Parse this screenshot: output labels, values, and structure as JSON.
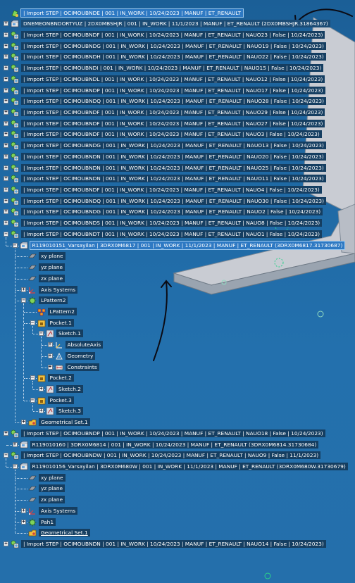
{
  "tree": [
    {
      "id": "r0",
      "label": "| Import STEP | OCIMOUBNDE | 001 | IN_WORK | 10/24/2023 | MANUF | ET_RENAULT",
      "icon": "part-icon",
      "depth": 0,
      "exp": "",
      "style": "sel"
    },
    {
      "id": "r1",
      "label": "DNEMEONBNDORTYUZ | 2DX0MBSHJR | 001 | IN_WORK | 11/1/2023 | MANUF | ET_RENAULT (2DX0MBSHJR.31864367)",
      "icon": "product-icon",
      "depth": 0,
      "exp": "+",
      "style": "plain"
    },
    {
      "id": "r2",
      "label": "| Import STEP | OCIMOUBNDF | 001 | IN_WORK | 10/24/2023 | MANUF | ET_RENAULT | NAUO23 | False | 10/24/2023)",
      "icon": "component-icon",
      "depth": 0,
      "exp": "+",
      "style": ""
    },
    {
      "id": "r3",
      "label": "| Import STEP | OCIMOUBNDG | 001 | IN_WORK | 10/24/2023 | MANUF | ET_RENAULT | NAUO19 | False | 10/24/2023)",
      "icon": "component-icon",
      "depth": 0,
      "exp": "+",
      "style": ""
    },
    {
      "id": "r4",
      "label": "| Import STEP | OCIMOUBNDH | 001 | IN_WORK | 10/24/2023 | MANUF | ET_RENAULT | NAUO22 | False | 10/24/2023)",
      "icon": "component-icon",
      "depth": 0,
      "exp": "+",
      "style": ""
    },
    {
      "id": "r5",
      "label": "| Import STEP | OCIMOUBNDI | 001 | IN_WORK | 10/24/2023 | MANUF | ET_RENAULT | NAUO15 | False | 10/24/2023)",
      "icon": "component-icon",
      "depth": 0,
      "exp": "+",
      "style": ""
    },
    {
      "id": "r6",
      "label": "| Import STEP | OCIMOUBNDL | 001 | IN_WORK | 10/24/2023 | MANUF | ET_RENAULT | NAUO12 | False | 10/24/2023)",
      "icon": "component-icon",
      "depth": 0,
      "exp": "+",
      "style": ""
    },
    {
      "id": "r7",
      "label": "| Import STEP | OCIMOUBNDP | 001 | IN_WORK | 10/24/2023 | MANUF | ET_RENAULT | NAUO17 | False | 10/24/2023)",
      "icon": "component-icon",
      "depth": 0,
      "exp": "+",
      "style": ""
    },
    {
      "id": "r8",
      "label": "| Import STEP | OCIMOUBNDQ | 001 | IN_WORK | 10/24/2023 | MANUF | ET_RENAULT | NAUO28 | False | 10/24/2023)",
      "icon": "component-icon",
      "depth": 0,
      "exp": "+",
      "style": ""
    },
    {
      "id": "r9",
      "label": "| Import STEP | OCIMOUBNDF | 001 | IN_WORK | 10/24/2023 | MANUF | ET_RENAULT | NAUO29 | False | 10/24/2023)",
      "icon": "component-icon",
      "depth": 0,
      "exp": "+",
      "style": ""
    },
    {
      "id": "r10",
      "label": "| Import STEP | OCIMOUBNDF | 001 | IN_WORK | 10/24/2023 | MANUF | ET_RENAULT | NAUO27 | False | 10/24/2023)",
      "icon": "component-icon",
      "depth": 0,
      "exp": "+",
      "style": ""
    },
    {
      "id": "r11",
      "label": "| Import STEP | OCIMOUBNDF | 001 | IN_WORK | 10/24/2023 | MANUF | ET_RENAULT | NAUO3 | False | 10/24/2023)",
      "icon": "component-icon",
      "depth": 0,
      "exp": "+",
      "style": ""
    },
    {
      "id": "r12",
      "label": "| Import STEP | OCIMOUBNDG | 001 | IN_WORK | 10/24/2023 | MANUF | ET_RENAULT | NAUO13 | False | 10/24/2023)",
      "icon": "component-icon",
      "depth": 0,
      "exp": "+",
      "style": ""
    },
    {
      "id": "r13",
      "label": "| Import STEP | OCIMOUBNDN | 001 | IN_WORK | 10/24/2023 | MANUF | ET_RENAULT | NAUO20 | False | 10/24/2023)",
      "icon": "component-icon",
      "depth": 0,
      "exp": "+",
      "style": ""
    },
    {
      "id": "r14",
      "label": "| Import STEP | OCIMOUBNDN | 001 | IN_WORK | 10/24/2023 | MANUF | ET_RENAULT | NAUO25 | False | 10/24/2023)",
      "icon": "component-icon",
      "depth": 0,
      "exp": "+",
      "style": ""
    },
    {
      "id": "r15",
      "label": "| Import STEP | OCIMOUBNDN | 001 | IN_WORK | 10/24/2023 | MANUF | ET_RENAULT | NAUO11 | False | 10/24/2023)",
      "icon": "component-icon",
      "depth": 0,
      "exp": "+",
      "style": ""
    },
    {
      "id": "r16",
      "label": "| Import STEP | OCIMOUBNDF | 001 | IN_WORK | 10/24/2023 | MANUF | ET_RENAULT | NAUO4 | False | 10/24/2023)",
      "icon": "component-icon",
      "depth": 0,
      "exp": "+",
      "style": ""
    },
    {
      "id": "r17",
      "label": "| Import STEP | OCIMOUBNDQ | 001 | IN_WORK | 10/24/2023 | MANUF | ET_RENAULT | NAUO30 | False | 10/24/2023)",
      "icon": "component-icon",
      "depth": 0,
      "exp": "+",
      "style": ""
    },
    {
      "id": "r18",
      "label": "| Import STEP | OCIMOUBNDG | 001 | IN_WORK | 10/24/2023 | MANUF | ET_RENAULT | NAUO2 | False | 10/24/2023)",
      "icon": "component-icon",
      "depth": 0,
      "exp": "+",
      "style": ""
    },
    {
      "id": "r19",
      "label": "| Import STEP | OCIMOUBNDS | 001 | IN_WORK | 10/24/2023 | MANUF | ET_RENAULT | NAUO8 | False | 10/24/2023)",
      "icon": "component-icon",
      "depth": 0,
      "exp": "+",
      "style": ""
    },
    {
      "id": "r20",
      "label": "| Import STEP | OCIMOUBNDT | 001 | IN_WORK | 10/24/2023 | MANUF | ET_RENAULT | NAUO1 | False | 10/24/2023)",
      "icon": "component-icon",
      "depth": 0,
      "exp": "-",
      "style": ""
    },
    {
      "id": "r21",
      "label": "R119010151_Varsayilan | 3DRX0M6817 | 001 | IN_WORK | 11/1/2023 | MANUF | ET_RENAULT (3DRX0M6817.31730687)",
      "icon": "product-icon",
      "depth": 1,
      "exp": "-",
      "style": "sel"
    },
    {
      "id": "r22",
      "label": "xy plane",
      "icon": "plane-icon",
      "depth": 2,
      "exp": "",
      "style": ""
    },
    {
      "id": "r23",
      "label": "yz plane",
      "icon": "plane-icon",
      "depth": 2,
      "exp": "",
      "style": ""
    },
    {
      "id": "r24",
      "label": "zx plane",
      "icon": "plane-icon",
      "depth": 2,
      "exp": "",
      "style": ""
    },
    {
      "id": "r25",
      "label": "Axis Systems",
      "icon": "axis-system-icon",
      "depth": 2,
      "exp": "+",
      "style": ""
    },
    {
      "id": "r26",
      "label": "LPattern2",
      "icon": "gear-body-icon",
      "depth": 2,
      "exp": "-",
      "style": ""
    },
    {
      "id": "r27",
      "label": "LPattern2",
      "icon": "pattern-icon",
      "depth": 3,
      "exp": "",
      "style": ""
    },
    {
      "id": "r28",
      "label": "Pocket.1",
      "icon": "pocket-icon",
      "depth": 3,
      "exp": "-",
      "style": ""
    },
    {
      "id": "r29",
      "label": "Sketch.1",
      "icon": "sketch-icon",
      "depth": 4,
      "exp": "-",
      "style": ""
    },
    {
      "id": "r30",
      "label": "AbsoluteAxis",
      "icon": "absolute-axis-icon",
      "depth": 5,
      "exp": "+",
      "style": ""
    },
    {
      "id": "r31",
      "label": "Geometry",
      "icon": "geometry-icon",
      "depth": 5,
      "exp": "+",
      "style": ""
    },
    {
      "id": "r32",
      "label": "Constraints",
      "icon": "constraints-icon",
      "depth": 5,
      "exp": "+",
      "style": ""
    },
    {
      "id": "r33",
      "label": "Pocket.2",
      "icon": "pocket-icon",
      "depth": 3,
      "exp": "-",
      "style": ""
    },
    {
      "id": "r34",
      "label": "Sketch.2",
      "icon": "sketch-icon",
      "depth": 4,
      "exp": "+",
      "style": ""
    },
    {
      "id": "r35",
      "label": "Pocket.3",
      "icon": "pocket-icon",
      "depth": 3,
      "exp": "-",
      "style": ""
    },
    {
      "id": "r36",
      "label": "Sketch.3",
      "icon": "sketch-icon",
      "depth": 4,
      "exp": "+",
      "style": ""
    },
    {
      "id": "r37",
      "label": "Geometrical Set.1",
      "icon": "geometrical-set-icon",
      "depth": 2,
      "exp": "+",
      "style": ""
    },
    {
      "id": "r38",
      "label": "| Import STEP | OCIMOUBNDP | 001 | IN_WORK | 10/24/2023 | MANUF | ET_RENAULT | NAUO18 | False | 10/24/2023)",
      "icon": "component-icon",
      "depth": 0,
      "exp": "+",
      "style": ""
    },
    {
      "id": "r39",
      "label": "R119010160 | 3DRX0M6814 | 001 | IN_WORK | 10/24/2023 | MANUF | ET_RENAULT (3DRX0M6814.31730684)",
      "icon": "product-icon",
      "depth": 1,
      "exp": "+",
      "style": ""
    },
    {
      "id": "r40",
      "label": "| Import STEP | OCIMOUBNDW | 001 | IN_WORK | 10/24/2023 | MANUF | ET_RENAULT | NAUO9 | False | 11/1/2023)",
      "icon": "component-icon",
      "depth": 0,
      "exp": "-",
      "style": ""
    },
    {
      "id": "r41",
      "label": "R119010156_Varsayilan | 3DRX0M680W | 001 | IN_WORK | 11/1/2023 | MANUF | ET_RENAULT (3DRX0M680W.31730679)",
      "icon": "product-icon",
      "depth": 1,
      "exp": "-",
      "style": ""
    },
    {
      "id": "r42",
      "label": "xy plane",
      "icon": "plane-icon",
      "depth": 2,
      "exp": "",
      "style": ""
    },
    {
      "id": "r43",
      "label": "yz plane",
      "icon": "plane-icon",
      "depth": 2,
      "exp": "",
      "style": ""
    },
    {
      "id": "r44",
      "label": "zx plane",
      "icon": "plane-icon",
      "depth": 2,
      "exp": "",
      "style": ""
    },
    {
      "id": "r45",
      "label": "Axis Systems",
      "icon": "axis-system-icon",
      "depth": 2,
      "exp": "+",
      "style": ""
    },
    {
      "id": "r46",
      "label": "Pah1",
      "icon": "gear-body-icon",
      "depth": 2,
      "exp": "+",
      "style": ""
    },
    {
      "id": "r47",
      "label": "Geometrical Set.1",
      "icon": "geometrical-set-icon",
      "depth": 2,
      "exp": "",
      "style": "ul"
    },
    {
      "id": "r48",
      "label": "| Import STEP | OCIMOUBNDN | 001 | IN_WORK | 10/24/2023 | MANUF | ET_RENAULT | NAUO14 | False | 10/24/2023)",
      "icon": "component-icon",
      "depth": 0,
      "exp": "+",
      "style": ""
    }
  ],
  "colors": {
    "background": "#1f69a4",
    "label_bg": "#153e61",
    "selected_bg": "#2e79c3",
    "model_face": "#c9ccd3",
    "annotation_ink": "#0b0b14"
  }
}
